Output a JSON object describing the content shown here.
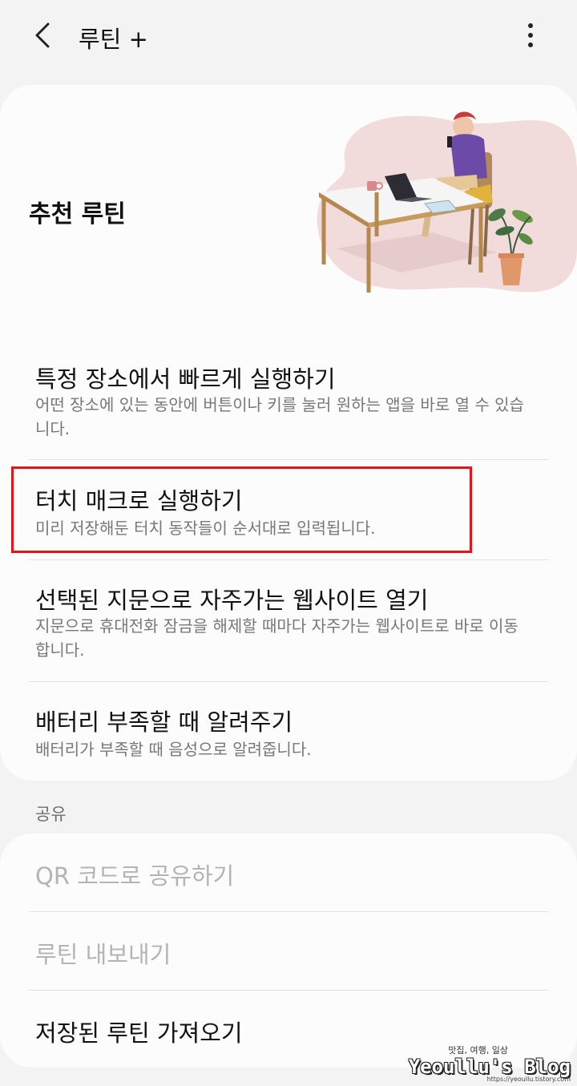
{
  "appbar": {
    "title": "루틴 +",
    "back_icon": "chevron-left-icon",
    "more_icon": "more-vertical-icon"
  },
  "recommended": {
    "title": "추천 루틴",
    "illustration": "person-at-desk-illustration",
    "items": [
      {
        "title": "특정 장소에서 빠르게 실행하기",
        "desc": "어떤 장소에 있는 동안에 버튼이나 키를 눌러 원하는 앱을 바로 열 수 있습니다."
      },
      {
        "title": "터치 매크로 실행하기",
        "desc": "미리 저장해둔 터치 동작들이 순서대로 입력됩니다."
      },
      {
        "title": "선택된 지문으로 자주가는 웹사이트 열기",
        "desc": "지문으로 휴대전화 잠금을 해제할 때마다 자주가는 웹사이트로 바로 이동합니다."
      },
      {
        "title": "배터리 부족할 때 알려주기",
        "desc": "배터리가 부족할 때 음성으로 알려줍니다."
      }
    ]
  },
  "share": {
    "header": "공유",
    "items": [
      {
        "label": "QR 코드로 공유하기",
        "enabled": false
      },
      {
        "label": "루틴 내보내기",
        "enabled": false
      },
      {
        "label": "저장된 루틴 가져오기",
        "enabled": true
      }
    ]
  },
  "watermark": {
    "tagline": "맛집, 여행, 일상",
    "name": "Yeoullu's Blog",
    "url": "https://yeoullu.tistory.com"
  },
  "colors": {
    "background": "#f3f3f3",
    "card": "#fcfcfc",
    "highlight": "#e5141b",
    "disabled_text": "#b4b4b4",
    "secondary_text": "#777777"
  }
}
